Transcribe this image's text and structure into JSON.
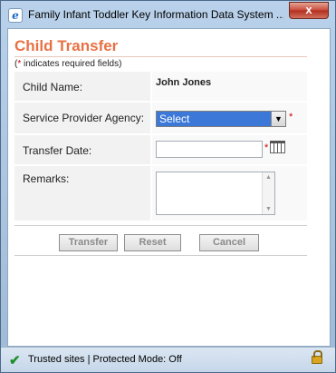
{
  "window": {
    "title": "Family Infant Toddler Key Information Data System ...",
    "close_symbol": "x"
  },
  "form": {
    "heading": "Child Transfer",
    "required_note_star": "*",
    "required_note_text": " indicates required fields)",
    "required_note_open": "(",
    "fields": {
      "child_name_label": "Child Name:",
      "child_name_value": "John Jones",
      "agency_label": "Service Provider Agency:",
      "agency_selected": "Select",
      "transfer_date_label": "Transfer Date:",
      "transfer_date_value": "",
      "remarks_label": "Remarks:",
      "remarks_value": ""
    },
    "required_star": "*"
  },
  "buttons": {
    "transfer": "Transfer",
    "reset": "Reset",
    "cancel": "Cancel"
  },
  "statusbar": {
    "text": "Trusted sites | Protected Mode: Off"
  },
  "colors": {
    "heading": "#e87144",
    "required": "#cc0000",
    "select_highlight": "#3b78d8"
  },
  "icons": [
    "ie-icon",
    "close-icon",
    "chevron-down-icon",
    "calendar-icon",
    "check-icon",
    "lock-icon"
  ]
}
